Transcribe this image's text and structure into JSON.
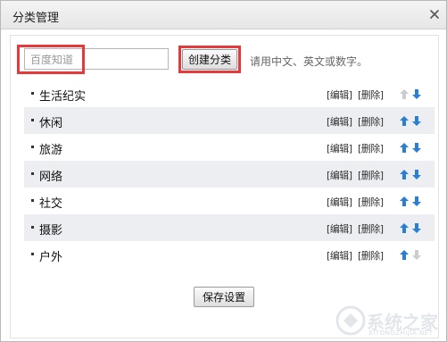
{
  "dialog": {
    "title": "分类管理",
    "close_icon": "close-icon"
  },
  "form": {
    "input_value": "百度知道",
    "create_label": "创建分类",
    "hint": "请用中文、英文或数字。"
  },
  "categories": [
    {
      "name": "生活纪实",
      "edit": "[编辑]",
      "delete": "[删除]",
      "up_enabled": false,
      "down_enabled": true
    },
    {
      "name": "休闲",
      "edit": "[编辑]",
      "delete": "[删除]",
      "up_enabled": true,
      "down_enabled": true
    },
    {
      "name": "旅游",
      "edit": "[编辑]",
      "delete": "[删除]",
      "up_enabled": true,
      "down_enabled": true
    },
    {
      "name": "网络",
      "edit": "[编辑]",
      "delete": "[删除]",
      "up_enabled": true,
      "down_enabled": true
    },
    {
      "name": "社交",
      "edit": "[编辑]",
      "delete": "[删除]",
      "up_enabled": true,
      "down_enabled": true
    },
    {
      "name": "摄影",
      "edit": "[编辑]",
      "delete": "[删除]",
      "up_enabled": true,
      "down_enabled": true
    },
    {
      "name": "户外",
      "edit": "[编辑]",
      "delete": "[删除]",
      "up_enabled": true,
      "down_enabled": false
    }
  ],
  "footer": {
    "save_label": "保存设置"
  },
  "watermark": {
    "text": "系统之家",
    "subtext": "XITONGZHIJIA.NET"
  },
  "colors": {
    "highlight": "#e53a3a",
    "arrow_active": "#2a7fd4",
    "arrow_disabled": "#c9ccd1",
    "row_shade": "#eceef1"
  }
}
